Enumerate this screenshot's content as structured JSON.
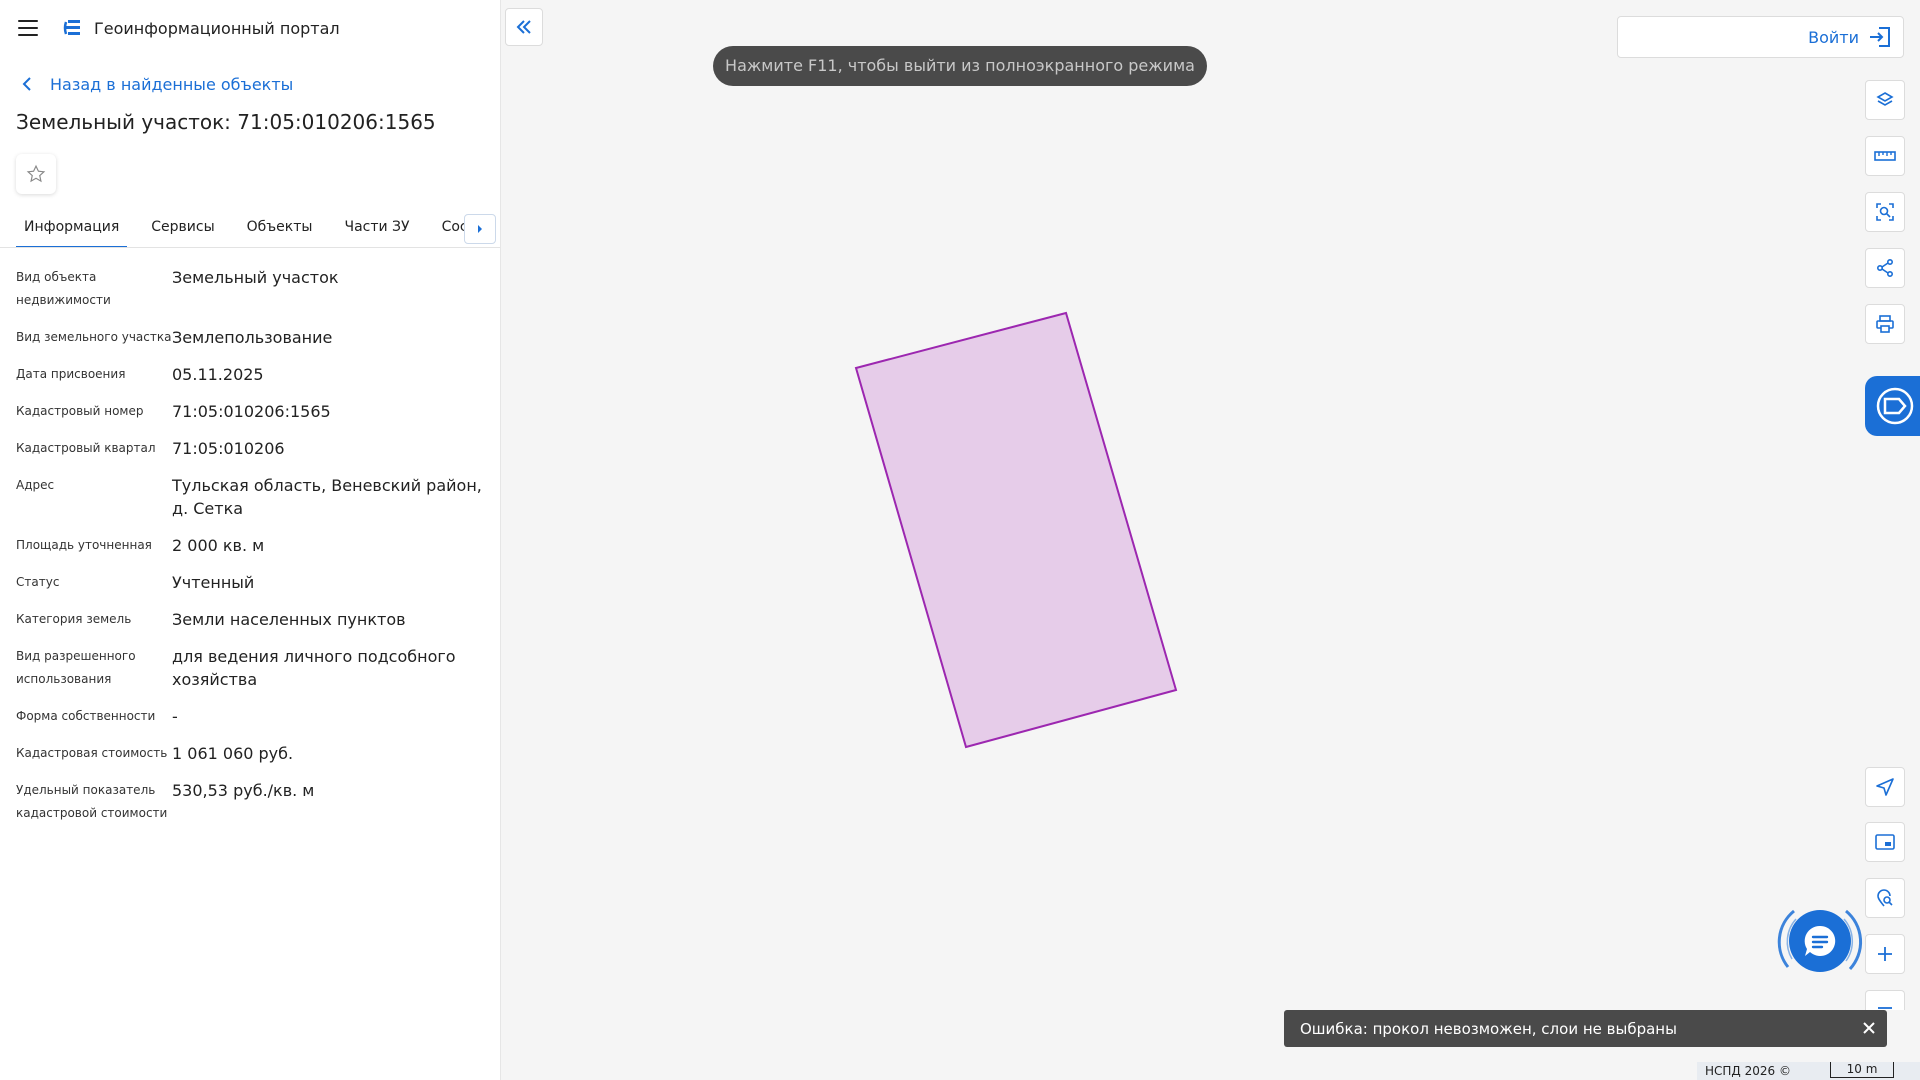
{
  "header": {
    "title": "Геоинформационный портал"
  },
  "back_link": {
    "label": "Назад в найденные объекты"
  },
  "object": {
    "title": "Земельный участок: 71:05:010206:1565"
  },
  "tabs": [
    {
      "label": "Информация"
    },
    {
      "label": "Сервисы"
    },
    {
      "label": "Объекты"
    },
    {
      "label": "Части ЗУ"
    },
    {
      "label": "Состав"
    }
  ],
  "props": [
    {
      "label": "Вид объекта недвижимости",
      "value": "Земельный участок"
    },
    {
      "label": "Вид земельного участка",
      "value": "Землепользование"
    },
    {
      "label": "Дата присвоения",
      "value": "05.11.2025"
    },
    {
      "label": "Кадастровый номер",
      "value": "71:05:010206:1565"
    },
    {
      "label": "Кадастровый квартал",
      "value": "71:05:010206"
    },
    {
      "label": "Адрес",
      "value": "Тульская область, Веневский район, д. Сетка"
    },
    {
      "label": "Площадь уточненная",
      "value": "2 000 кв. м"
    },
    {
      "label": "Статус",
      "value": "Учтенный"
    },
    {
      "label": "Категория земель",
      "value": "Земли населенных пунктов"
    },
    {
      "label": "Вид разрешенного использования",
      "value": "для ведения личного подсобного хозяйства"
    },
    {
      "label": "Форма собственности",
      "value": "-"
    },
    {
      "label": "Кадастровая стоимость",
      "value": "1 061 060 руб."
    },
    {
      "label": "Удельный показатель кадастровой стоимости",
      "value": "530,53 руб./кв. м"
    }
  ],
  "map": {
    "fullscreen_hint": "Нажмите F11, чтобы выйти из полноэкранного режима",
    "login_label": "Войти",
    "error_message": "Ошибка: прокол невозможен, слои не выбраны",
    "attribution": "НСПД 2026 ©",
    "scale_label": "10 m",
    "parcel_fill": "#e6cce9",
    "parcel_stroke": "#9c27b0",
    "accent": "#1b6fd6"
  }
}
